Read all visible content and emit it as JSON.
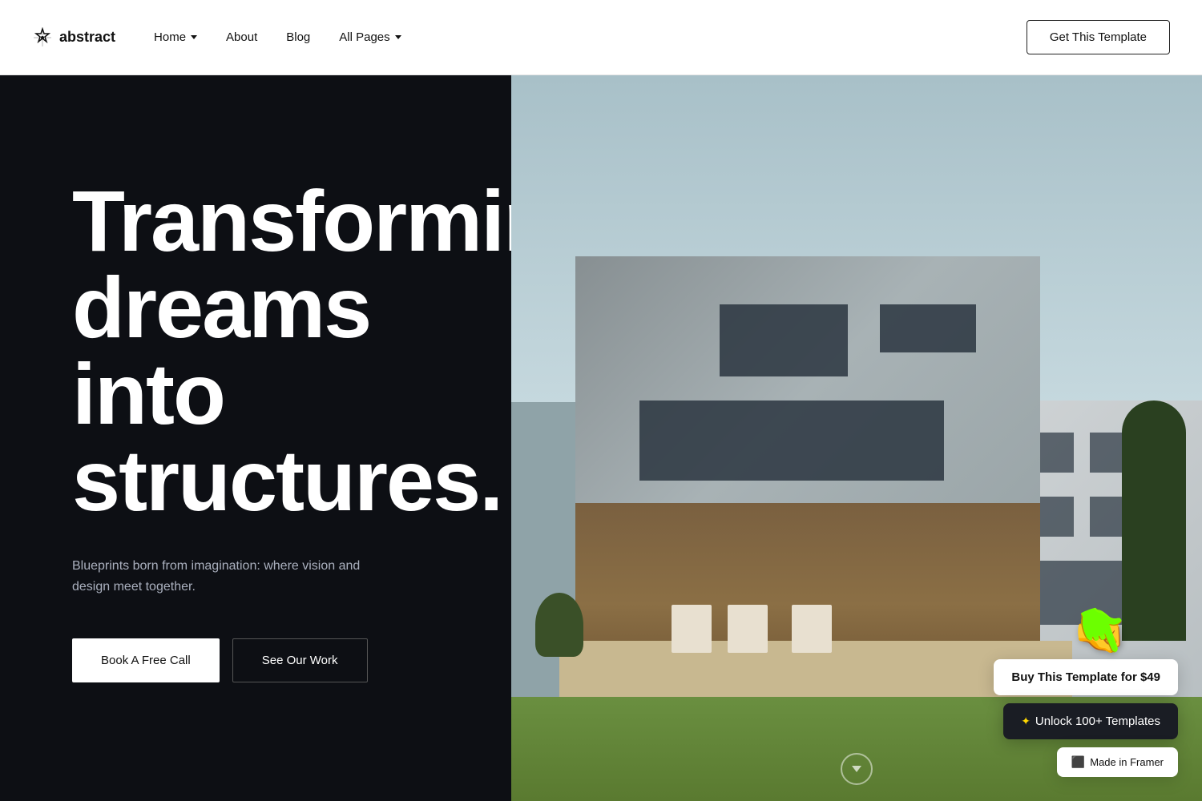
{
  "navbar": {
    "logo_text": "abstract",
    "nav_items": [
      {
        "label": "Home",
        "has_dropdown": true
      },
      {
        "label": "About",
        "has_dropdown": false
      },
      {
        "label": "Blog",
        "has_dropdown": false
      },
      {
        "label": "All Pages",
        "has_dropdown": true
      }
    ],
    "cta_button": "Get This Template"
  },
  "hero": {
    "headline": "Transforming dreams into structures.",
    "subtext": "Blueprints born from imagination: where vision and design meet together.",
    "btn_primary": "Book A Free Call",
    "btn_secondary": "See Our Work"
  },
  "widgets": {
    "buy": "Buy This Template for $49",
    "unlock": "✦ Unlock 100+ Templates",
    "framer": "Made in Framer"
  },
  "colors": {
    "dark_bg": "#0d0f14",
    "accent_yellow": "#f5d020"
  }
}
